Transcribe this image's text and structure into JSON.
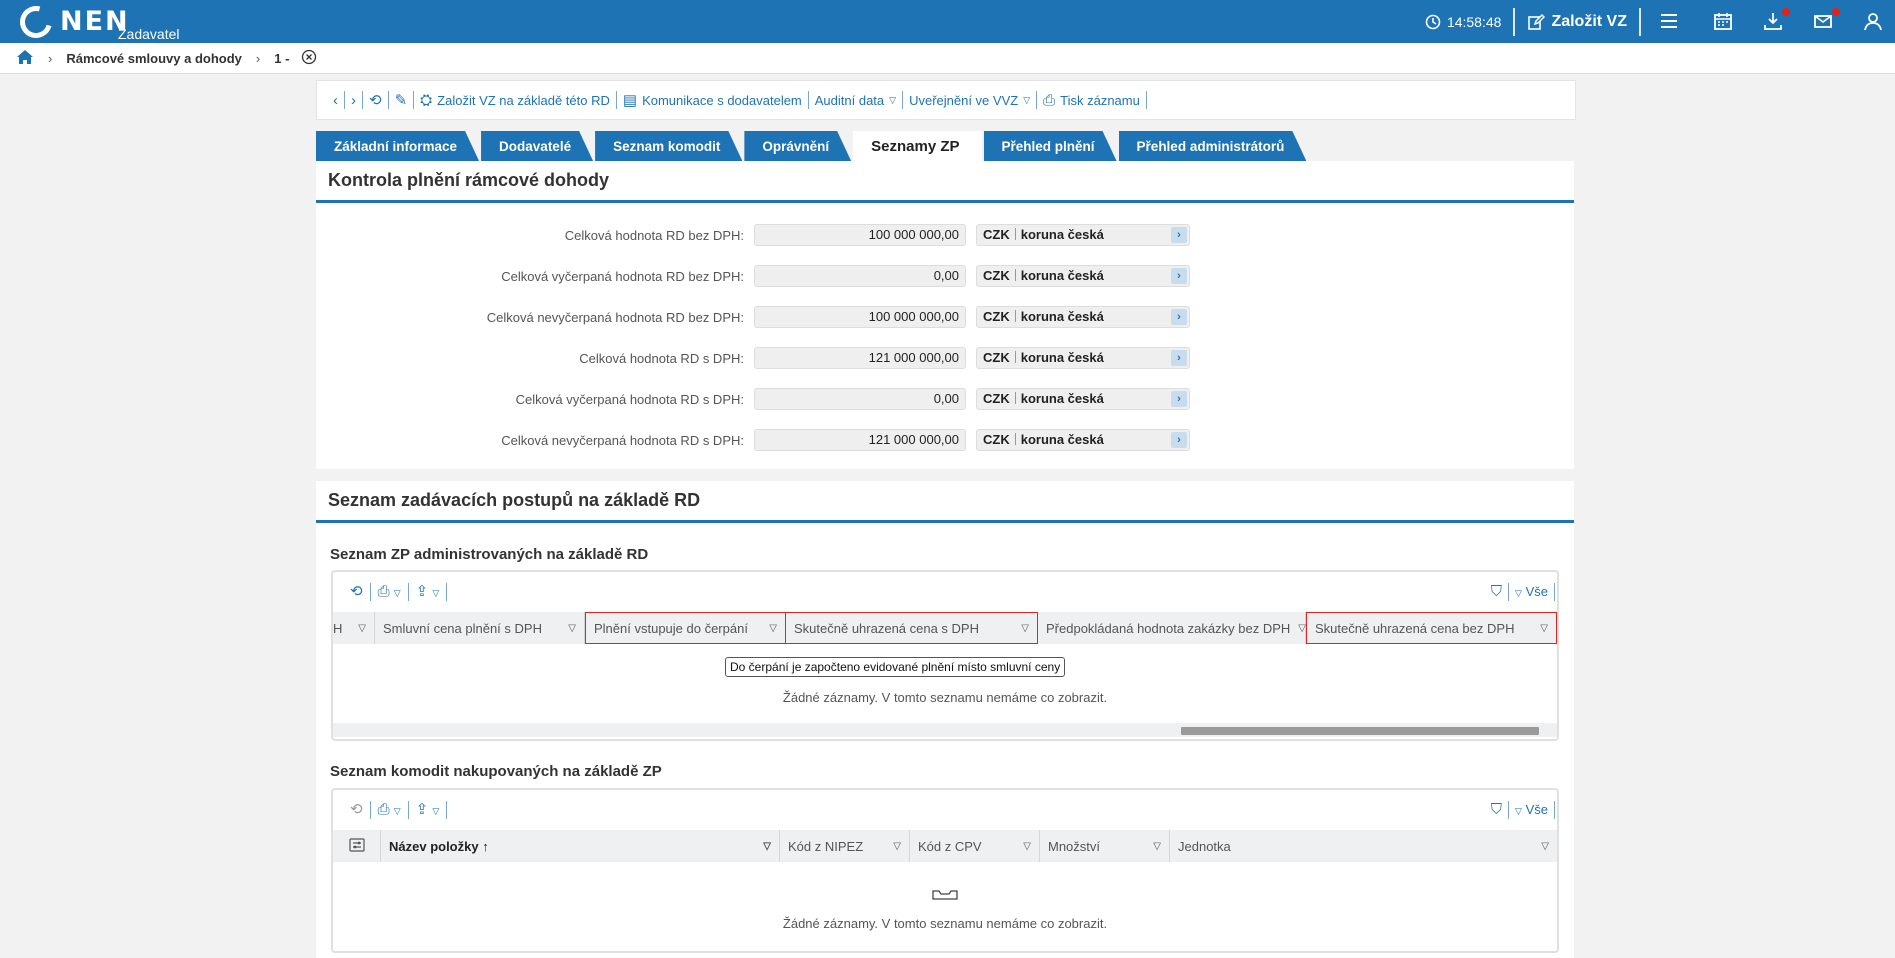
{
  "app": {
    "logo_text": "NEN",
    "logo_sub": "Zadavatel"
  },
  "topbar": {
    "time": "14:58:48",
    "create_label": "Založit VZ"
  },
  "breadcrumb": {
    "items": [
      "Rámcové smlouvy a dohody",
      "1 -"
    ]
  },
  "toolbar": {
    "items": [
      "Založit VZ na základě této RD",
      "Komunikace s dodavatelem",
      "Auditní data",
      "Uveřejnění ve VVZ",
      "Tisk záznamu"
    ]
  },
  "tabs": [
    "Základní informace",
    "Dodavatelé",
    "Seznam komodit",
    "Oprávnění",
    "Seznamy ZP",
    "Přehled plnění",
    "Přehled administrátorů"
  ],
  "kontrola": {
    "title": "Kontrola plnění rámcové dohody",
    "currency_code": "CZK",
    "currency_name": "koruna česká",
    "rows": [
      {
        "label": "Celková hodnota RD bez DPH:",
        "value": "100 000 000,00"
      },
      {
        "label": "Celková vyčerpaná hodnota RD bez DPH:",
        "value": "0,00"
      },
      {
        "label": "Celková nevyčerpaná hodnota RD bez DPH:",
        "value": "100 000 000,00"
      },
      {
        "label": "Celková hodnota RD s DPH:",
        "value": "121 000 000,00"
      },
      {
        "label": "Celková vyčerpaná hodnota RD s DPH:",
        "value": "0,00"
      },
      {
        "label": "Celková nevyčerpaná hodnota RD s DPH:",
        "value": "121 000 000,00"
      }
    ]
  },
  "seznam": {
    "title": "Seznam zadávacích postupů na základě RD",
    "grid1": {
      "title": "Seznam ZP administrovaných na základě RD",
      "all_label": "Vše",
      "columns": [
        "H",
        "Smluvní cena plnění s DPH",
        "Plnění vstupuje do čerpání",
        "Skutečně uhrazená cena s DPH",
        "Předpokládaná hodnota zakázky bez DPH",
        "Skutečně uhrazená cena bez DPH"
      ],
      "tooltip": "Do čerpání je započteno evidované plnění místo smluvní ceny",
      "empty": "Žádné záznamy. V tomto seznamu nemáme co zobrazit."
    },
    "grid2": {
      "title": "Seznam komodit nakupovaných na základě ZP",
      "all_label": "Vše",
      "columns": [
        "Název položky",
        "Kód z NIPEZ",
        "Kód z CPV",
        "Množství",
        "Jednotka"
      ],
      "empty": "Žádné záznamy. V tomto seznamu nemáme co zobrazit."
    }
  },
  "colors": {
    "brand": "#1e73b4",
    "highlight": "#e02424"
  }
}
